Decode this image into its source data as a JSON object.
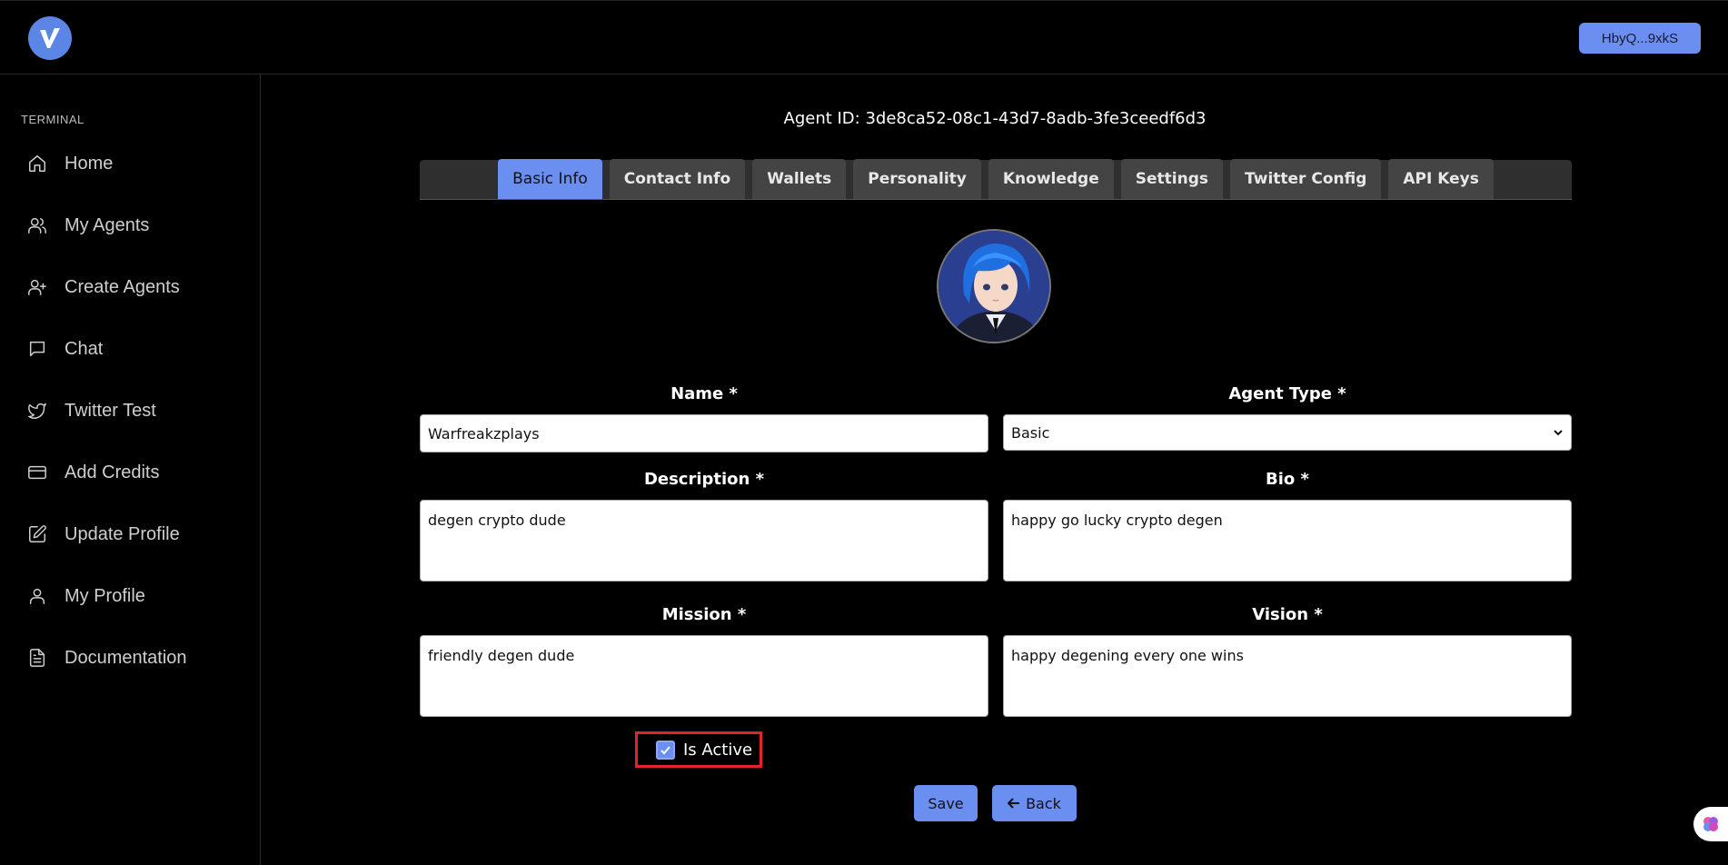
{
  "header": {
    "wallet_button": "HbyQ...9xkS"
  },
  "sidebar": {
    "section_label": "TERMINAL",
    "items": [
      {
        "label": "Home",
        "icon": "home-icon"
      },
      {
        "label": "My Agents",
        "icon": "users-icon"
      },
      {
        "label": "Create Agents",
        "icon": "user-plus-icon"
      },
      {
        "label": "Chat",
        "icon": "chat-icon"
      },
      {
        "label": "Twitter Test",
        "icon": "twitter-icon"
      },
      {
        "label": "Add Credits",
        "icon": "credit-card-icon"
      },
      {
        "label": "Update Profile",
        "icon": "edit-icon"
      },
      {
        "label": "My Profile",
        "icon": "user-icon"
      },
      {
        "label": "Documentation",
        "icon": "document-icon"
      }
    ]
  },
  "main": {
    "agent_id": "Agent ID: 3de8ca52-08c1-43d7-8adb-3fe3ceedf6d3",
    "tabs": [
      {
        "label": "Basic Info",
        "active": true
      },
      {
        "label": "Contact Info",
        "active": false
      },
      {
        "label": "Wallets",
        "active": false
      },
      {
        "label": "Personality",
        "active": false
      },
      {
        "label": "Knowledge",
        "active": false
      },
      {
        "label": "Settings",
        "active": false
      },
      {
        "label": "Twitter Config",
        "active": false
      },
      {
        "label": "API Keys",
        "active": false
      }
    ],
    "form": {
      "name_label": "Name *",
      "name_value": "Warfreakzplays",
      "agent_type_label": "Agent Type *",
      "agent_type_value": "Basic",
      "description_label": "Description *",
      "description_value": "degen crypto dude",
      "bio_label": "Bio *",
      "bio_value": "happy go lucky crypto degen",
      "mission_label": "Mission *",
      "mission_value": "friendly degen dude",
      "vision_label": "Vision *",
      "vision_value": "happy degening every one wins",
      "is_active_label": "Is Active",
      "is_active": true
    },
    "save_button": "Save",
    "back_button": "Back"
  },
  "colors": {
    "accent": "#6b8ff0",
    "background": "#000000",
    "highlight": "#e0242c"
  }
}
